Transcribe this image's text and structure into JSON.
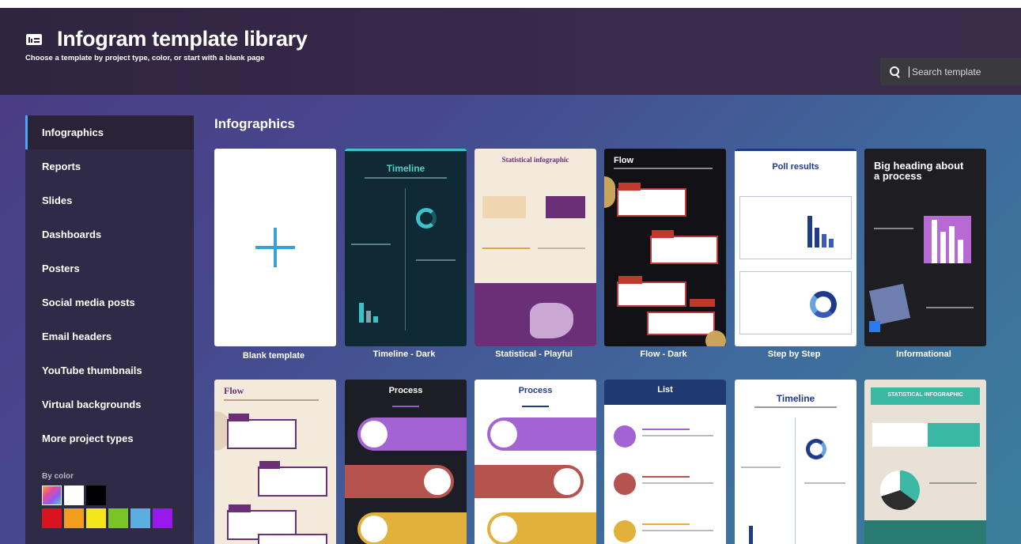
{
  "header": {
    "title": "Infogram template library",
    "subtitle": "Choose a template by project type, color, or start with a blank page",
    "search_placeholder": "Search template"
  },
  "sidebar": {
    "items": [
      {
        "label": "Infographics",
        "active": true
      },
      {
        "label": "Reports"
      },
      {
        "label": "Slides"
      },
      {
        "label": "Dashboards"
      },
      {
        "label": "Posters"
      },
      {
        "label": "Social media posts"
      },
      {
        "label": "Email headers"
      },
      {
        "label": "YouTube thumbnails"
      },
      {
        "label": "Virtual backgrounds"
      },
      {
        "label": "More project types"
      }
    ],
    "by_color_label": "By color",
    "colors_row1": [
      "gradient",
      "#ffffff",
      "#000000"
    ],
    "colors_row2": [
      "#d9141e",
      "#f39c1e",
      "#f5e61c",
      "#79c526",
      "#5aaee0",
      "#9a18f0"
    ]
  },
  "main": {
    "section_title": "Infographics",
    "row1": [
      {
        "label": "Blank template",
        "thumb_title": ""
      },
      {
        "label": "Timeline - Dark",
        "thumb_title": "Timeline"
      },
      {
        "label": "Statistical - Playful",
        "thumb_title": "Statistical infographic"
      },
      {
        "label": "Flow - Dark",
        "thumb_title": "Flow"
      },
      {
        "label": "Step by Step",
        "thumb_title": "Poll results"
      },
      {
        "label": "Informational",
        "thumb_title": "Big heading about a process"
      }
    ],
    "row2": [
      {
        "thumb_title": "Flow"
      },
      {
        "thumb_title": "Process"
      },
      {
        "thumb_title": "Process"
      },
      {
        "thumb_title": "List"
      },
      {
        "thumb_title": "Timeline"
      },
      {
        "thumb_title": "STATISTICAL INFOGRAPHIC"
      }
    ]
  },
  "colors": {
    "accent": "#4aa8f0",
    "header_bg": "#2f2540",
    "sidebar_bg": "#2f2a45"
  }
}
